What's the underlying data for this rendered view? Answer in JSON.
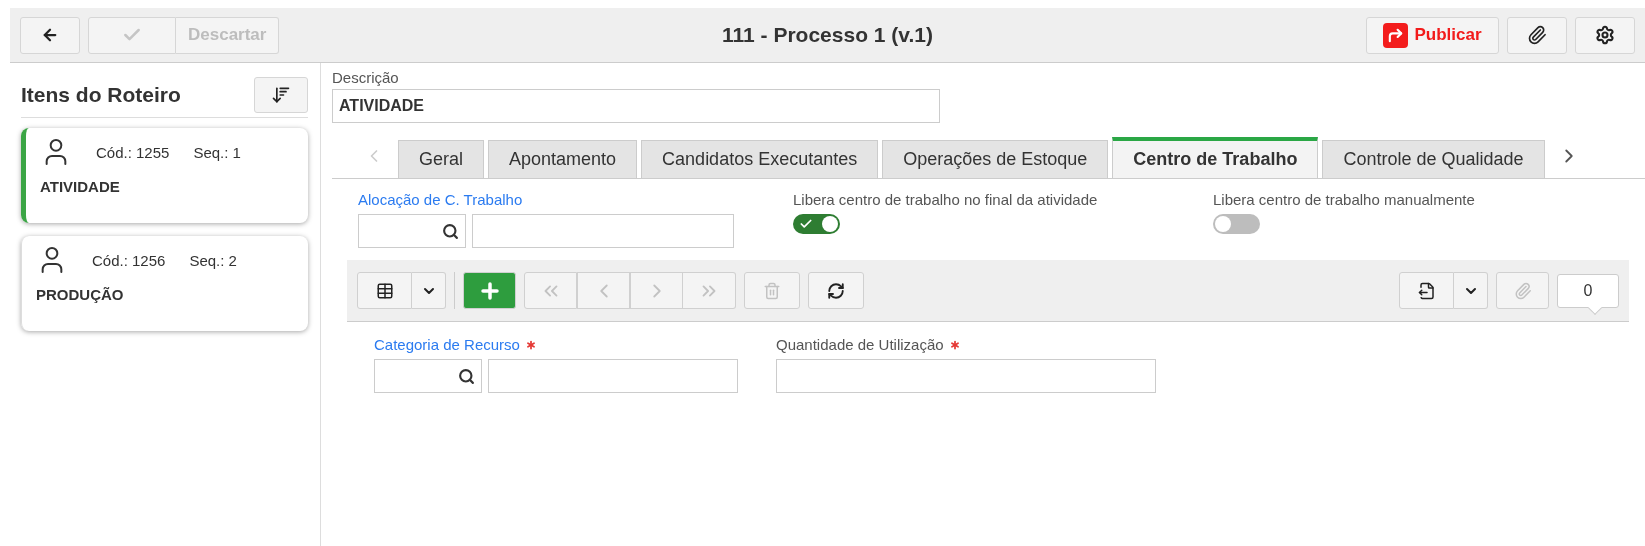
{
  "header": {
    "title": "111 - Processo 1 (v.1)",
    "discard_label": "Descartar",
    "confirm_disabled": true,
    "discard_disabled": true,
    "publish_label": "Publicar"
  },
  "sidebar": {
    "title": "Itens do Roteiro",
    "items": [
      {
        "code": "Cód.: 1255",
        "seq": "Seq.: 1",
        "name": "ATIVIDADE",
        "selected": true
      },
      {
        "code": "Cód.: 1256",
        "seq": "Seq.: 2",
        "name": "PRODUÇÃO",
        "selected": false
      }
    ]
  },
  "description": {
    "label": "Descrição",
    "value": "ATIVIDADE"
  },
  "tabs": [
    {
      "label": "Geral",
      "selected": false
    },
    {
      "label": "Apontamento",
      "selected": false
    },
    {
      "label": "Candidatos Executantes",
      "selected": false
    },
    {
      "label": "Operações de Estoque",
      "selected": false
    },
    {
      "label": "Centro de Trabalho",
      "selected": true
    },
    {
      "label": "Controle de Qualidade",
      "selected": false
    }
  ],
  "settings": {
    "allocation_label": "Alocação de C. Trabalho",
    "toggles": [
      {
        "label": "Libera centro de trabalho no final da atividade",
        "on": true
      },
      {
        "label": "Libera centro de trabalho manualmente",
        "on": false
      }
    ]
  },
  "toolbar": {
    "nav_disabled": true,
    "delete_disabled": true,
    "attach_disabled": true,
    "count": "0"
  },
  "form": [
    {
      "label": "Categoria de Recurso",
      "kind": "lookup",
      "required": true,
      "link": true
    },
    {
      "label": "Quantidade de Utilização",
      "kind": "text",
      "required": true,
      "link": false
    }
  ]
}
